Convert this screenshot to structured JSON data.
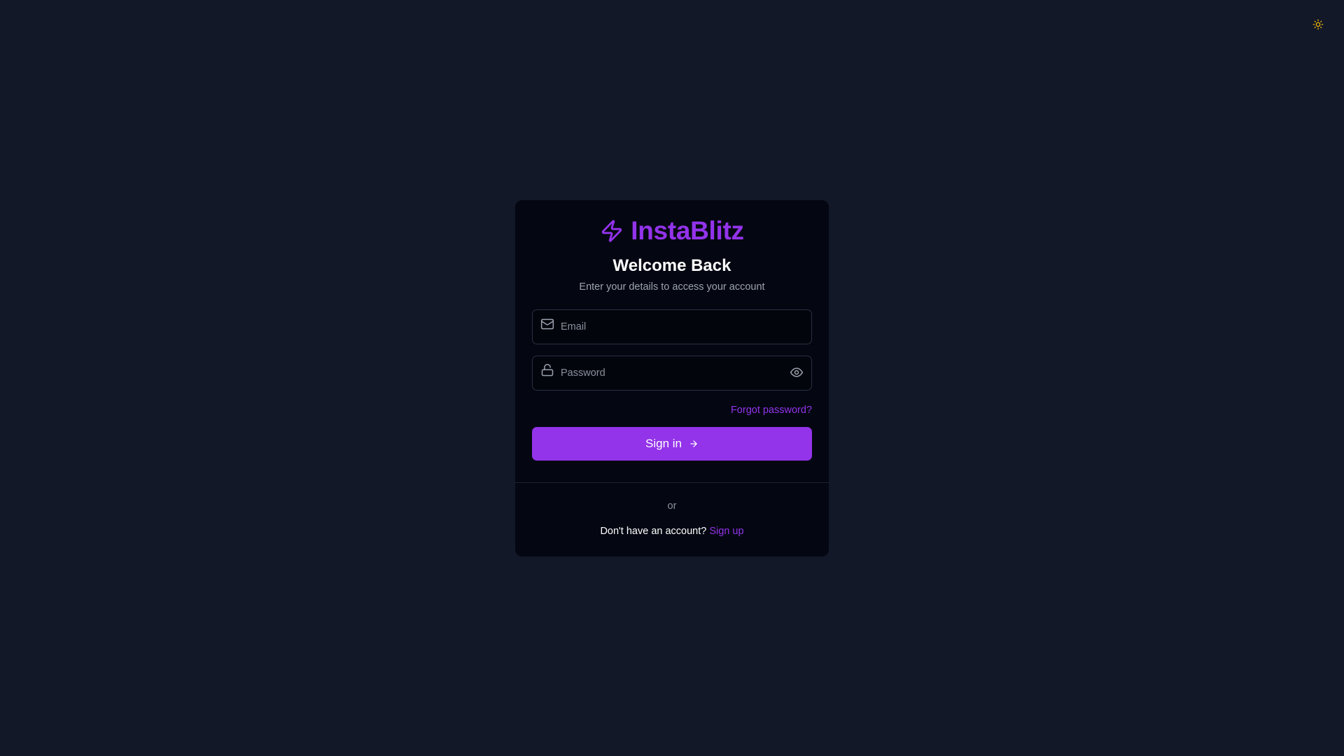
{
  "theme_toggle": {
    "icon": "sun-icon",
    "color": "#eab308"
  },
  "brand": {
    "name": "InstaBlitz",
    "icon": "lightning-bolt-icon",
    "color": "#9333ea"
  },
  "heading": {
    "title": "Welcome Back",
    "subtitle": "Enter your details to access your account"
  },
  "form": {
    "email": {
      "placeholder": "Email",
      "value": "",
      "icon": "mail-icon"
    },
    "password": {
      "placeholder": "Password",
      "value": "",
      "icon": "lock-icon",
      "toggle_icon": "eye-icon"
    },
    "forgot_label": "Forgot password?",
    "submit_label": "Sign in",
    "submit_icon": "arrow-right-icon"
  },
  "footer": {
    "separator": "or",
    "prompt": "Don't have an account?",
    "signup_label": "Sign up"
  },
  "colors": {
    "background": "#121828",
    "card": "#040712",
    "accent": "#9333ea"
  }
}
